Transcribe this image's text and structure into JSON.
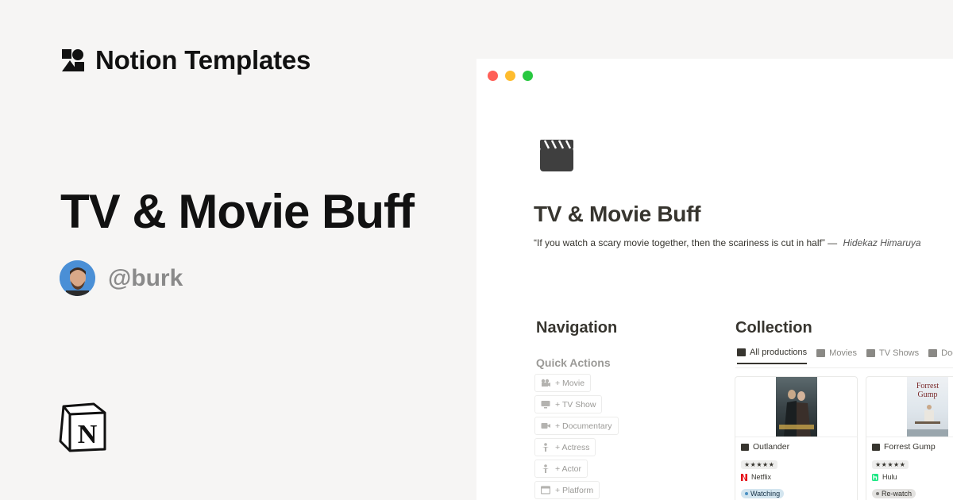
{
  "brand": {
    "title": "Notion Templates"
  },
  "hero": {
    "title": "TV & Movie Buff"
  },
  "author": {
    "handle": "@burk"
  },
  "window": {
    "page": {
      "title": "TV & Movie Buff",
      "quote": "“If you watch a scary movie together, then the scariness is cut in half” —",
      "quote_author": "Hidekaz Himaruya",
      "icon": "clapperboard-icon"
    },
    "navigation": {
      "heading": "Navigation",
      "quick_actions_heading": "Quick Actions",
      "actions": [
        {
          "label": "+ Movie",
          "icon": "movie-camera-icon"
        },
        {
          "label": "+ TV Show",
          "icon": "tv-icon"
        },
        {
          "label": "+ Documentary",
          "icon": "video-camera-icon"
        },
        {
          "label": "+ Actress",
          "icon": "person-icon"
        },
        {
          "label": "+ Actor",
          "icon": "person-icon"
        },
        {
          "label": "+ Platform",
          "icon": "screen-icon"
        }
      ]
    },
    "collection": {
      "heading": "Collection",
      "tabs": [
        {
          "label": "All productions",
          "active": true
        },
        {
          "label": "Movies",
          "active": false
        },
        {
          "label": "TV Shows",
          "active": false
        },
        {
          "label": "Doc",
          "active": false
        }
      ],
      "cards": [
        {
          "title": "Outlander",
          "rating": "★★★★★",
          "platform": "Netflix",
          "platform_color": "#e50914",
          "status": "Watching",
          "status_bg": "#d3e5ef",
          "status_dot": "#4a90c2"
        },
        {
          "title": "Forrest Gump",
          "rating": "★★★★★",
          "platform": "Hulu",
          "platform_color": "#1ce783",
          "status": "Re-watch",
          "status_bg": "#e3e2e0",
          "status_dot": "#787774"
        }
      ]
    }
  },
  "colors": {
    "accent": "#37352f",
    "background": "#f6f5f4"
  }
}
